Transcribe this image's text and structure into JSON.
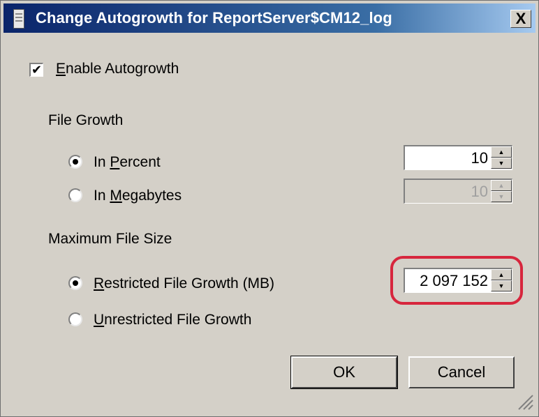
{
  "window": {
    "title": "Change Autogrowth for ReportServer$CM12_log",
    "close_label": "X"
  },
  "enable_autogrowth": {
    "label_accel": "E",
    "label_rest": "nable Autogrowth",
    "checked": true,
    "check_glyph": "✔"
  },
  "file_growth": {
    "group_label": "File Growth",
    "in_percent": {
      "label_pre": "In ",
      "label_accel": "P",
      "label_rest": "ercent",
      "checked": true
    },
    "in_megabytes": {
      "label_pre": "In ",
      "label_accel": "M",
      "label_rest": "egabytes",
      "checked": false
    },
    "percent_value": "10",
    "megabytes_value": "10"
  },
  "max_file_size": {
    "group_label": "Maximum File Size",
    "restricted": {
      "label_accel": "R",
      "label_rest": "estricted File Growth (MB)",
      "checked": true
    },
    "unrestricted": {
      "label_accel": "U",
      "label_rest": "nrestricted File Growth",
      "checked": false
    },
    "restricted_value": "2 097 152"
  },
  "buttons": {
    "ok": "OK",
    "cancel": "Cancel"
  },
  "icons": {
    "spin_up": "▲",
    "spin_down": "▼"
  },
  "colors": {
    "highlight": "#d7263d",
    "title_bar": "#0a246a"
  }
}
